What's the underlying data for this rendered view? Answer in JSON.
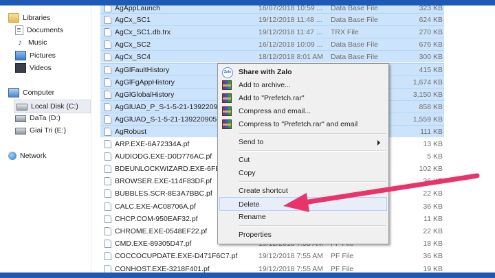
{
  "nav": {
    "libraries": "Libraries",
    "documents": "Documents",
    "music": "Music",
    "pictures": "Pictures",
    "videos": "Videos",
    "computer": "Computer",
    "local_disk": "Local Disk (C:)",
    "data_drive": "DaTa (D:)",
    "giai_tri": "Giai Tri (E:)",
    "network": "Network"
  },
  "files": [
    {
      "name": "AgAppLaunch",
      "date": "16/07/2018 10:59 ...",
      "type": "Data Base File",
      "size": "323 KB"
    },
    {
      "name": "AgCx_SC1",
      "date": "19/12/2018 11:48 ...",
      "type": "Data Base File",
      "size": "624 KB"
    },
    {
      "name": "AgCx_SC1.db.trx",
      "date": "19/12/2018 11:47 ...",
      "type": "TRX File",
      "size": "270 KB"
    },
    {
      "name": "AgCx_SC2",
      "date": "16/12/2018 10:09 ...",
      "type": "Data Base File",
      "size": "676 KB"
    },
    {
      "name": "AgCx_SC4",
      "date": "18/12/2018 8:01 AM",
      "type": "Data Base File",
      "size": "300 KB"
    },
    {
      "name": "AgGlFaultHistory",
      "date": "",
      "type": "",
      "size": "415 KB"
    },
    {
      "name": "AgGlFgAppHistory",
      "date": "",
      "type": "",
      "size": "1,674 KB"
    },
    {
      "name": "AgGlGlobalHistory",
      "date": "",
      "type": "",
      "size": "3,150 KB"
    },
    {
      "name": "AgGlUAD_P_S-1-5-21-1392209056",
      "date": "",
      "type": "",
      "size": "858 KB"
    },
    {
      "name": "AgGlUAD_S-1-5-21-1392209056-",
      "date": "",
      "type": "",
      "size": "1,559 KB"
    },
    {
      "name": "AgRobust",
      "date": "",
      "type": "",
      "size": "111 KB"
    },
    {
      "name": "ARP.EXE-6A72334A.pf",
      "date": "",
      "type": "",
      "size": "13 KB"
    },
    {
      "name": "AUDIODG.EXE-D0D776AC.pf",
      "date": "",
      "type": "",
      "size": "5 KB"
    },
    {
      "name": "BDEUNLOCKWIZARD.EXE-6FE96E",
      "date": "",
      "type": "",
      "size": "102 KB"
    },
    {
      "name": "BROWSER.EXE-114F83DF.pf",
      "date": "",
      "type": "",
      "size": "36 KB"
    },
    {
      "name": "BUBBLES.SCR-8E3A7BBC.pf",
      "date": "",
      "type": "",
      "size": "22 KB"
    },
    {
      "name": "CALC.EXE-AC08706A.pf",
      "date": "",
      "type": "",
      "size": "36 KB"
    },
    {
      "name": "CHCP.COM-950EAF32.pf",
      "date": "",
      "type": "",
      "size": "11 KB"
    },
    {
      "name": "CHROME.EXE-0548EF22.pf",
      "date": "",
      "type": "",
      "size": "22 KB"
    },
    {
      "name": "CMD.EXE-89305D47.pf",
      "date": "19/12/2018 7:55 AM",
      "type": "PF File",
      "size": "18 KB"
    },
    {
      "name": "COCCOCUPDATE.EXE-D471F6C7.pf",
      "date": "19/12/2018 7:55 AM",
      "type": "PF File",
      "size": "36 KB"
    },
    {
      "name": "CONHOST.EXE-3218F401.pf",
      "date": "19/12/2018 7:55 AM",
      "type": "PF File",
      "size": "19 KB"
    }
  ],
  "menu": {
    "share_zalo": "Share with Zalo",
    "add_archive": "Add to archive...",
    "add_prefetch": "Add to \"Prefetch.rar\"",
    "compress_email": "Compress and email...",
    "compress_prefetch_email": "Compress to \"Prefetch.rar\" and email",
    "send_to": "Send to",
    "cut": "Cut",
    "copy": "Copy",
    "create_shortcut": "Create shortcut",
    "delete": "Delete",
    "rename": "Rename",
    "properties": "Properties"
  },
  "colors": {
    "accent_bar": "#1d5ab8",
    "selection": "#cce4fb",
    "pointer_arrow": "#e8336b"
  },
  "icons": {
    "zalo": "zalo-icon",
    "winrar": "winrar-icon",
    "submenu": "chevron-right-icon"
  }
}
